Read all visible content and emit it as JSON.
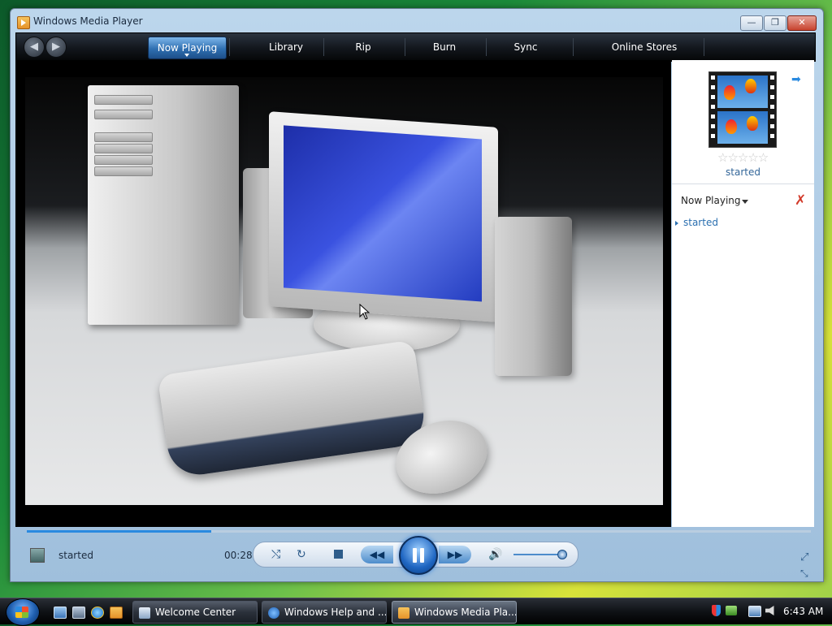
{
  "window": {
    "title": "Windows Media Player",
    "minimize": "—",
    "maximize": "❐",
    "close": "✕"
  },
  "nav": {
    "back_icon": "◀",
    "forward_icon": "▶",
    "tabs": [
      {
        "label": "Now Playing",
        "active": true
      },
      {
        "label": "Library"
      },
      {
        "label": "Rip"
      },
      {
        "label": "Burn"
      },
      {
        "label": "Sync"
      },
      {
        "label": "Online Stores"
      }
    ]
  },
  "right_pane": {
    "toggle_icon": "➡",
    "rating": "☆☆☆☆☆",
    "media_title": "started",
    "list_header": "Now Playing",
    "clear_icon": "✗",
    "playlist": [
      "started"
    ]
  },
  "controls": {
    "status_title": "started",
    "elapsed": "00:28",
    "progress_fraction": 0.235,
    "volume_fraction": 0.9,
    "shuffle_icon": "⤭",
    "repeat_icon": "↻",
    "rewind_icon": "◀◀",
    "forward_icon": "▶▶",
    "mute_icon": "🔊",
    "fullscreen_icon": "⤢",
    "compact_icon": "⤡"
  },
  "taskbar": {
    "tasks": [
      {
        "label": "Welcome Center"
      },
      {
        "label": "Windows Help and ..."
      },
      {
        "label": "Windows Media Pla...",
        "active": true
      }
    ],
    "clock": "6:43 AM"
  },
  "colors": {
    "accent": "#2a8ae0",
    "toolbar_dark": "#12161c",
    "active_tab": "#2f6fb1"
  }
}
